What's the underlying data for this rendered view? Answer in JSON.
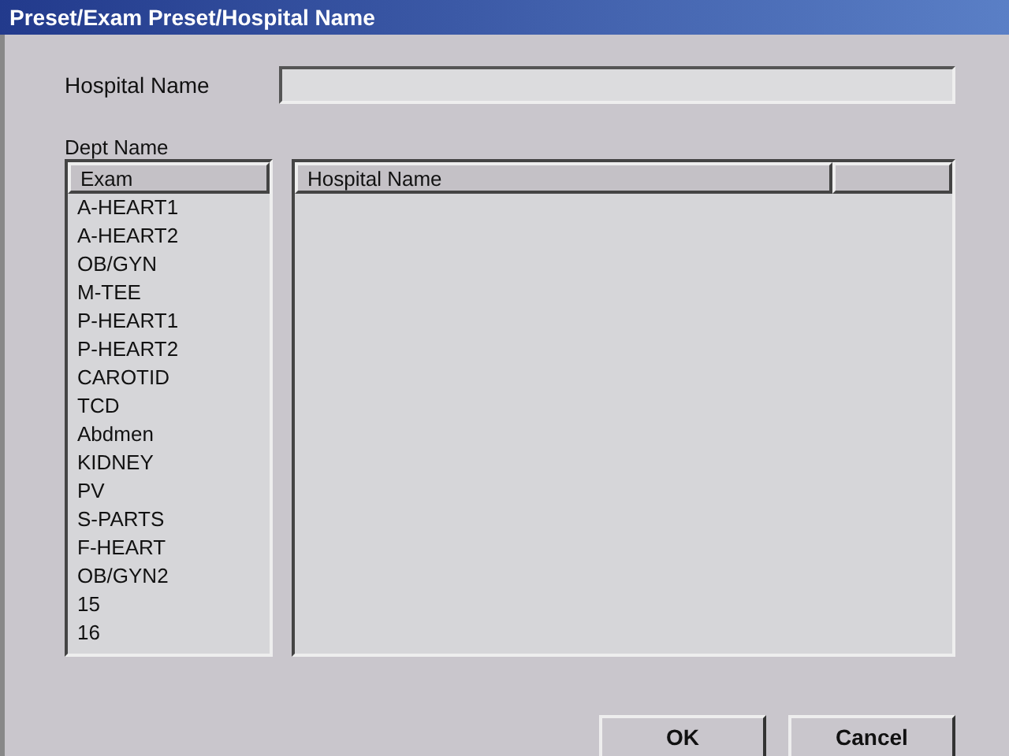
{
  "window": {
    "title": "Preset/Exam Preset/Hospital Name"
  },
  "hospital_name_field": {
    "label": "Hospital Name"
  },
  "dept_name_label": "Dept Name",
  "exam_list": {
    "header": "Exam",
    "items": [
      {
        "label": "A-HEART1"
      },
      {
        "label": "A-HEART2"
      },
      {
        "label": "OB/GYN"
      },
      {
        "label": "M-TEE"
      },
      {
        "label": "P-HEART1"
      },
      {
        "label": "P-HEART2"
      },
      {
        "label": "CAROTID"
      },
      {
        "label": "TCD"
      },
      {
        "label": "Abdmen"
      },
      {
        "label": "KIDNEY"
      },
      {
        "label": "PV"
      },
      {
        "label": "S-PARTS"
      },
      {
        "label": "F-HEART"
      },
      {
        "label": "OB/GYN2"
      },
      {
        "label": "15"
      },
      {
        "label": "16"
      }
    ]
  },
  "hospital_table": {
    "columns": [
      "Hospital Name"
    ]
  },
  "buttons": [
    "OK",
    "Cancel"
  ]
}
